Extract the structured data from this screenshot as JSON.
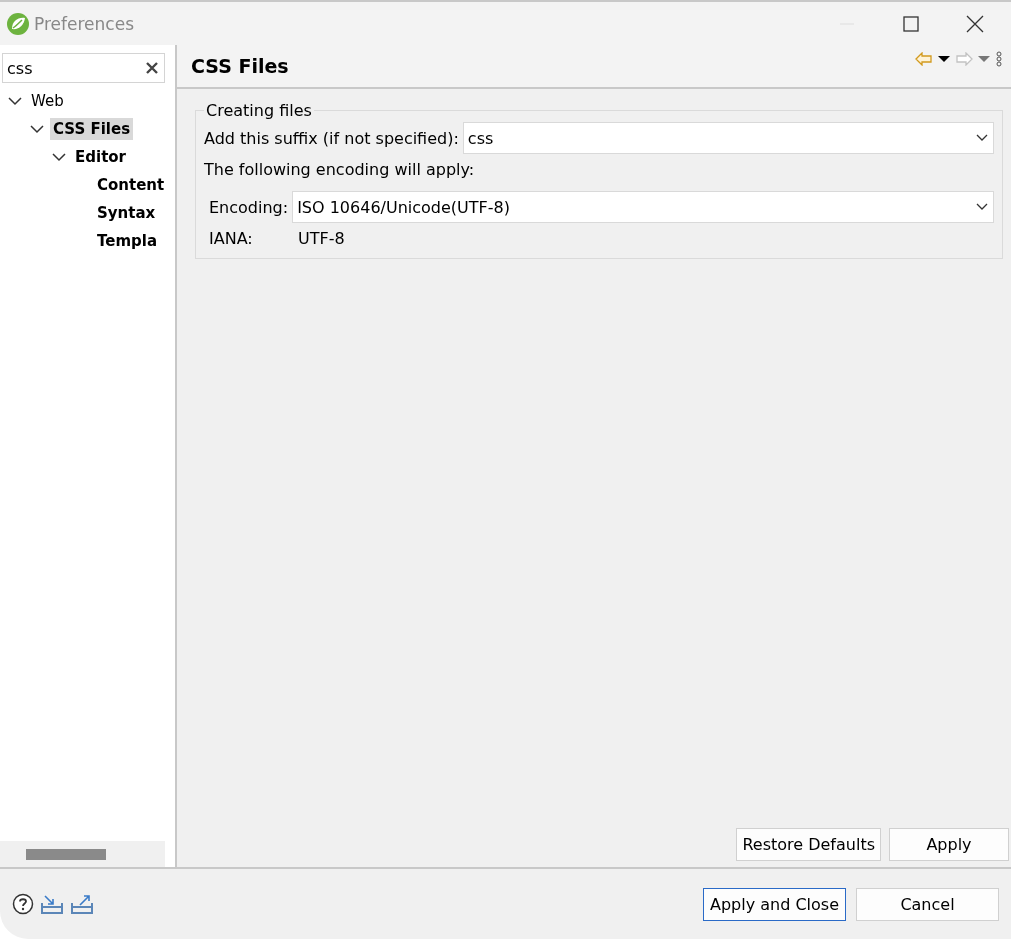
{
  "window": {
    "title": "Preferences"
  },
  "sidebar": {
    "filter": {
      "value": "css"
    },
    "tree": [
      {
        "label": "Web",
        "expanded": true,
        "selected": false,
        "children": [
          {
            "label": "CSS Files",
            "expanded": true,
            "selected": true,
            "children": [
              {
                "label": "Editor",
                "expanded": true,
                "selected": false,
                "children": [
                  {
                    "label": "Content",
                    "selected": false
                  },
                  {
                    "label": "Syntax",
                    "selected": false
                  },
                  {
                    "label": "Templa",
                    "selected": false
                  }
                ]
              }
            ]
          }
        ]
      }
    ]
  },
  "page": {
    "title": "CSS Files",
    "group": {
      "title": "Creating files",
      "suffix": {
        "label": "Add this suffix (if not specified):",
        "value": "css"
      },
      "note": "The following encoding will apply:",
      "encoding": {
        "label": "Encoding:",
        "value": "ISO 10646/Unicode(UTF-8)"
      },
      "iana": {
        "label": "IANA:",
        "value": "UTF-8"
      }
    },
    "buttons": [
      "Restore Defaults",
      "Apply"
    ]
  },
  "footer": {
    "buttons": [
      {
        "label": "Apply and Close",
        "selected": true
      },
      {
        "label": "Cancel",
        "selected": false
      }
    ]
  }
}
